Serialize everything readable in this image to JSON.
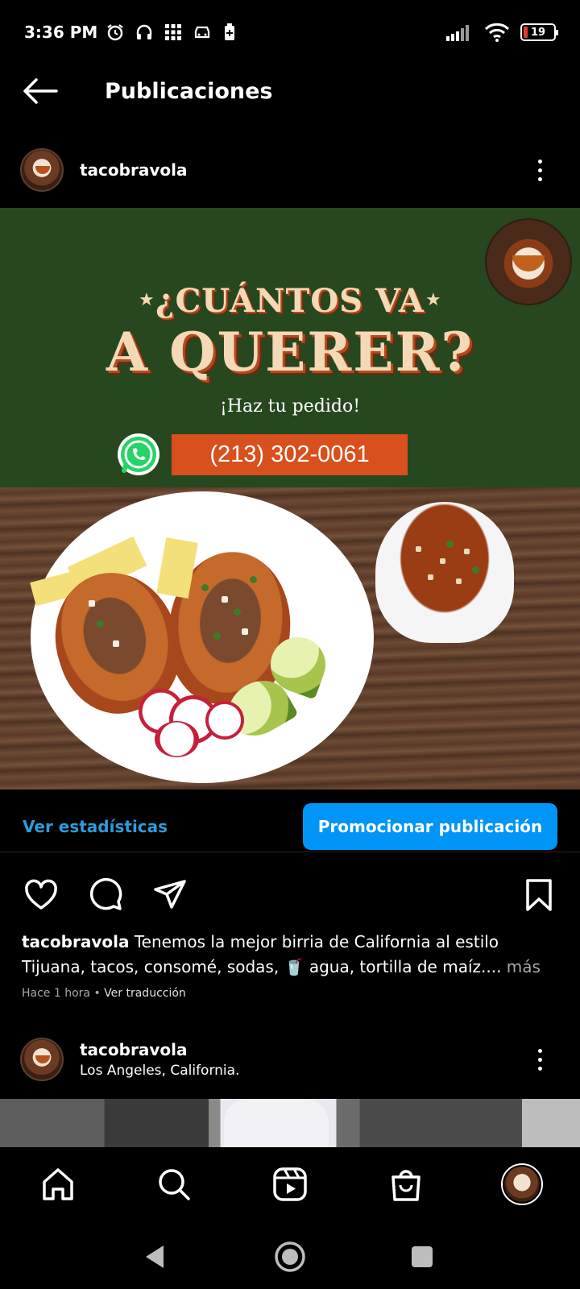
{
  "status_bar": {
    "time": "3:36 PM",
    "battery_level": "19",
    "icons": [
      "alarm-icon",
      "headset-icon",
      "keypad-icon",
      "car-icon",
      "battery-saver-icon",
      "signal-icon",
      "wifi-icon",
      "battery-icon"
    ]
  },
  "header": {
    "title": "Publicaciones",
    "back_icon": "arrow-left-icon"
  },
  "post": {
    "username": "tacobravola",
    "more_icon": "more-vertical-icon",
    "banner": {
      "line1": "¿CUÁNTOS VA",
      "line2": "A QUERER?",
      "cta": "¡Haz tu pedido!",
      "phone": "(213) 302-0061",
      "background_color": "#27471f",
      "phone_box_color": "#d8501d"
    },
    "stats_link": "Ver estadísticas",
    "promote_button": "Promocionar publicación",
    "caption_user": "tacobravola",
    "caption_text": " Tenemos la mejor birria de California al estilo Tijuana, tacos, consomé, sodas, 🥤 agua, tortilla de maíz.... ",
    "caption_more": "más",
    "time_ago": "Hace 1 hora",
    "separator": " • ",
    "translate_link": "Ver traducción"
  },
  "next_post": {
    "username": "tacobravola",
    "location": "Los Angeles, California."
  },
  "bottom_nav": {
    "items": [
      "home-icon",
      "search-icon",
      "reels-icon",
      "shop-icon",
      "profile-avatar"
    ]
  },
  "colors": {
    "accent": "#0095f6",
    "link": "#2d9cdb",
    "background": "#000000"
  }
}
